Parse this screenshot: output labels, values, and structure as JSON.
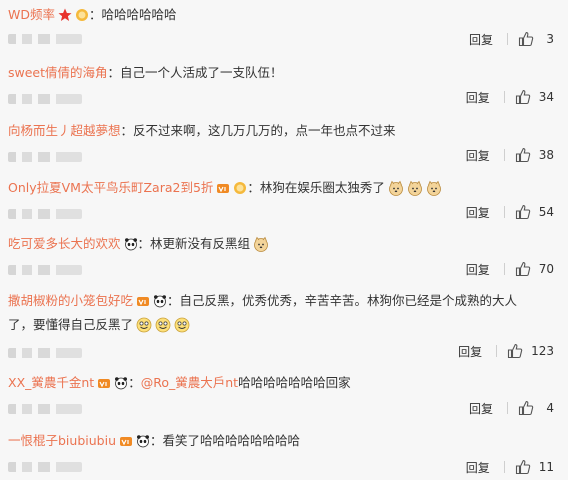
{
  "colors": {
    "username": "#eb7350",
    "text": "#333333",
    "background": "#f7f7f7"
  },
  "reply_label": "回复",
  "comments": [
    {
      "user": "WD频率",
      "sep": "：",
      "text": "哈哈哈哈哈哈",
      "likes": "3"
    },
    {
      "user": "sweet倩倩的海角",
      "sep": "：",
      "text": "自己一个人活成了一支队伍！",
      "likes": "34"
    },
    {
      "user": "向杨而生丿超越夢想",
      "sep": "：",
      "text": "反不过来啊，这几万几万的，点一年也点不过来",
      "likes": "38"
    },
    {
      "user": "Only拉夏VM太平鸟乐町Zara2到5折",
      "sep": "：",
      "text": "林狗在娱乐圈太独秀了",
      "likes": "54"
    },
    {
      "user": "吃可爱多长大的欢欢",
      "sep": "：",
      "text": "林更新没有反黑组",
      "likes": "70"
    },
    {
      "user": "撒胡椒粉的小笼包好吃",
      "sep": "：",
      "text": "自己反黑，优秀优秀，辛苦辛苦。林狗你已经是个成熟的大人",
      "text2": "了，要懂得自己反黑了",
      "likes": "123"
    },
    {
      "user": "XX_黉農千金nt",
      "sep": "：",
      "mention": "@Ro_黉農大戶nt",
      "text": " 哈哈哈哈哈哈哈回家",
      "likes": "4"
    },
    {
      "user": "一恨棍子biubiubiu",
      "sep": "：",
      "text": "看笑了哈哈哈哈哈哈哈哈",
      "likes": "11"
    }
  ]
}
